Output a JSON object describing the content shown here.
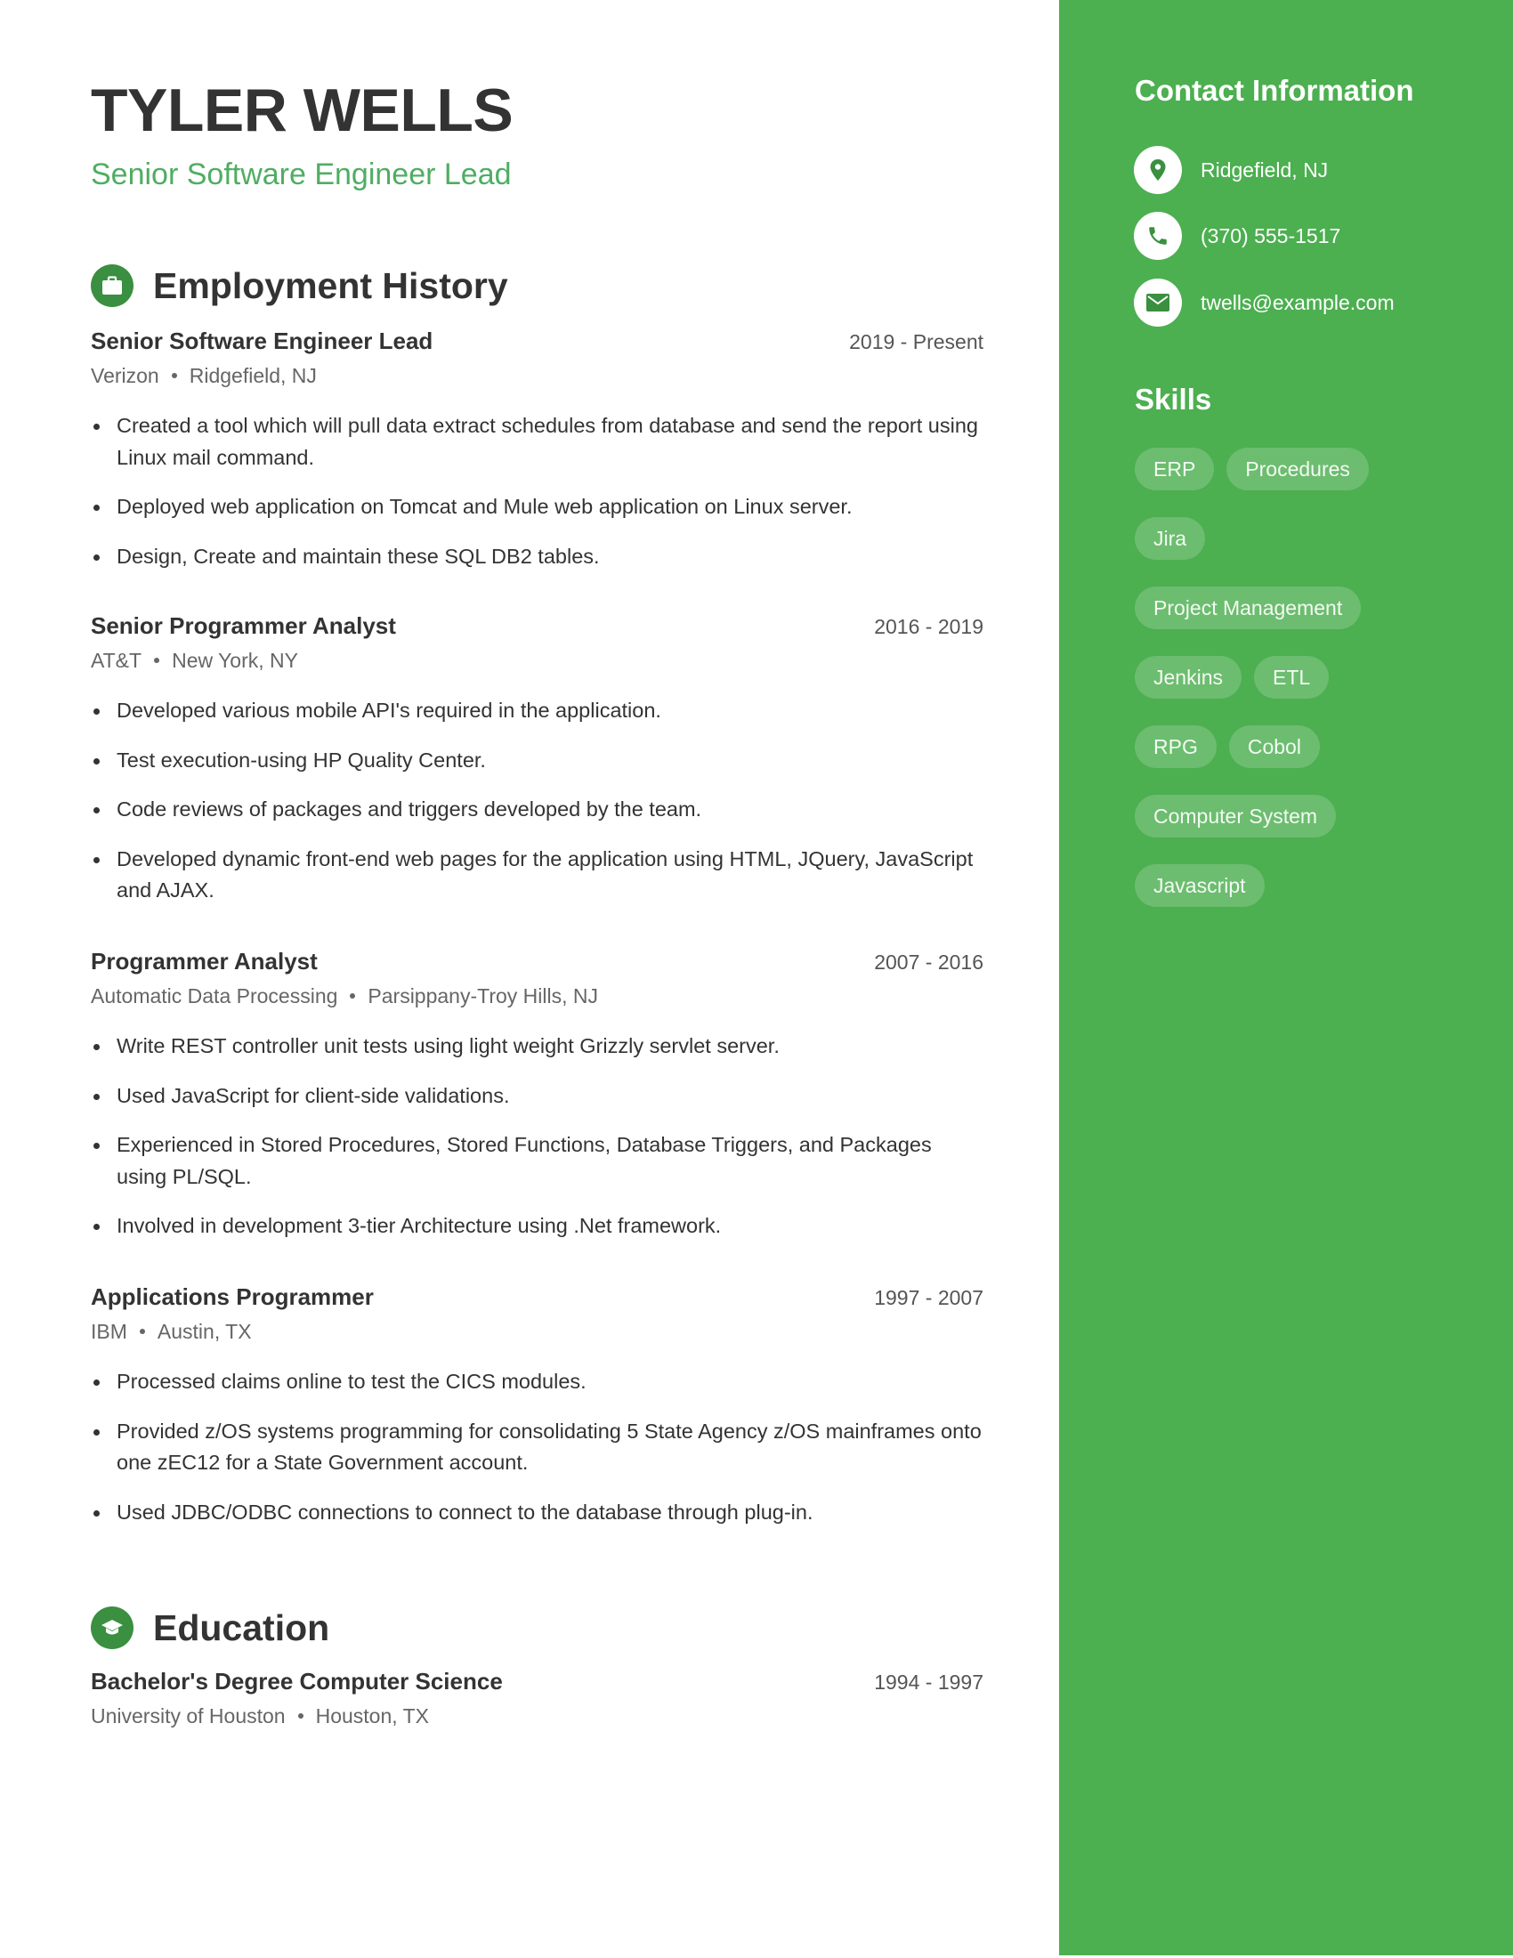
{
  "header": {
    "name": "TYLER WELLS",
    "title": "Senior Software Engineer Lead"
  },
  "colors": {
    "accent": "#4caf50",
    "section_icon": "#3a8f40",
    "subtitle": "#4fad63",
    "text": "#333333",
    "muted": "#666666"
  },
  "employment": {
    "heading": "Employment History",
    "icon": "briefcase-icon",
    "jobs": [
      {
        "title": "Senior Software Engineer Lead",
        "dates": "2019 - Present",
        "company": "Verizon",
        "location": "Ridgefield, NJ",
        "bullets": [
          "Created a tool which will pull data extract schedules from database and send the report using Linux mail command.",
          "Deployed web application on Tomcat and Mule web application on Linux server.",
          "Design, Create and maintain these SQL DB2 tables."
        ]
      },
      {
        "title": "Senior Programmer Analyst",
        "dates": "2016 - 2019",
        "company": "AT&T",
        "location": "New York, NY",
        "bullets": [
          "Developed various mobile API's required in the application.",
          "Test execution-using HP Quality Center.",
          "Code reviews of packages and triggers developed by the team.",
          "Developed dynamic front-end web pages for the application using HTML, JQuery, JavaScript and AJAX."
        ]
      },
      {
        "title": "Programmer Analyst",
        "dates": "2007 - 2016",
        "company": "Automatic Data Processing",
        "location": "Parsippany-Troy Hills, NJ",
        "bullets": [
          "Write REST controller unit tests using light weight Grizzly servlet server.",
          "Used JavaScript for client-side validations.",
          "Experienced in Stored Procedures, Stored Functions, Database Triggers, and Packages using PL/SQL.",
          "Involved in development 3-tier Architecture using .Net framework."
        ]
      },
      {
        "title": "Applications Programmer",
        "dates": "1997 - 2007",
        "company": "IBM",
        "location": "Austin, TX",
        "bullets": [
          "Processed claims online to test the CICS modules.",
          "Provided z/OS systems programming for consolidating 5 State Agency z/OS mainframes onto one zEC12 for a State Government account.",
          "Used JDBC/ODBC connections to connect to the database through plug-in."
        ]
      }
    ]
  },
  "education": {
    "heading": "Education",
    "icon": "graduation-cap-icon",
    "entries": [
      {
        "degree": "Bachelor's Degree Computer Science",
        "dates": "1994 - 1997",
        "school": "University of Houston",
        "location": "Houston, TX"
      }
    ]
  },
  "sidebar": {
    "contact_heading": "Contact Information",
    "contacts": [
      {
        "icon": "location-pin-icon",
        "text": "Ridgefield, NJ"
      },
      {
        "icon": "phone-icon",
        "text": "(370) 555-1517"
      },
      {
        "icon": "envelope-icon",
        "text": "twells@example.com"
      }
    ],
    "skills_heading": "Skills",
    "skills": [
      "ERP",
      "Procedures",
      "Jira",
      "Project Management",
      "Jenkins",
      "ETL",
      "RPG",
      "Cobol",
      "Computer System",
      "Javascript"
    ]
  }
}
